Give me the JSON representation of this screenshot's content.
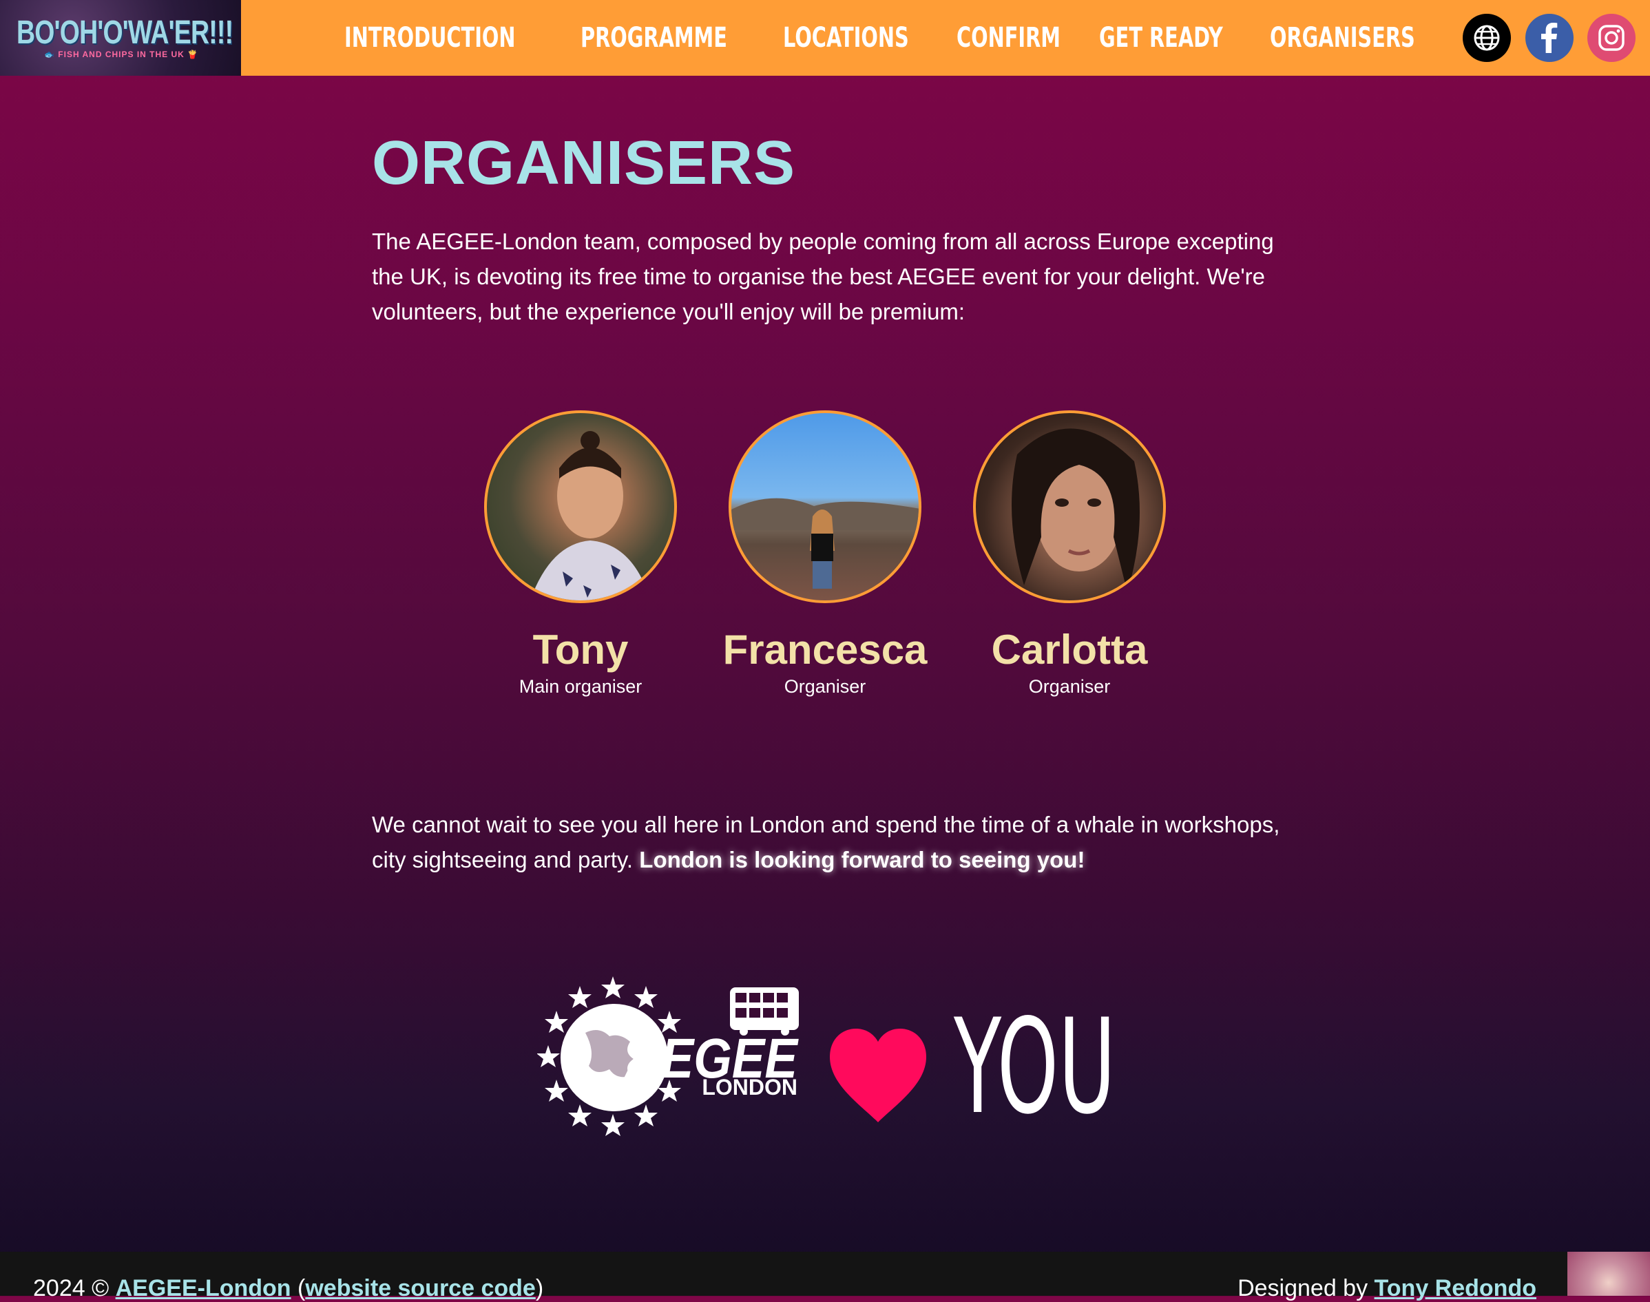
{
  "header": {
    "logo_title": "BO'OH'O'WA'ER!!!",
    "logo_subtitle": "🐟 FISH AND CHIPS IN THE UK 🍟",
    "nav": [
      "INTRODUCTION",
      "PROGRAMME",
      "LOCATIONS",
      "CONFIRM",
      "GET READY",
      "ORGANISERS"
    ],
    "social": [
      "globe-icon",
      "facebook-icon",
      "instagram-icon"
    ]
  },
  "main": {
    "title": "ORGANISERS",
    "intro": "The AEGEE-London team, composed by people coming from all across Europe excepting the UK, is devoting its free time to organise the best AEGEE event for your delight. We're volunteers, but the experience you'll enjoy will be premium:",
    "organisers": [
      {
        "name": "Tony",
        "role": "Main organiser"
      },
      {
        "name": "Francesca",
        "role": "Organiser"
      },
      {
        "name": "Carlotta",
        "role": "Organiser"
      }
    ],
    "outro": "We cannot wait to see you all here in London and spend the time of a whale in workshops, city sightseeing and party.",
    "outro_bold": "London is looking forward to seeing you!",
    "banner": {
      "logo_word": "AEGEE",
      "logo_sub": "LONDON",
      "you": "YOU"
    }
  },
  "footer": {
    "year_prefix": "2024 ©",
    "org_link": "AEGEE-London",
    "source_link": "website source code",
    "designed_by": "Designed by",
    "designer_link": "Tony Redondo"
  },
  "colors": {
    "nav_bg": "#ff9d36",
    "title": "#a8e3e8",
    "name": "#f3e1a8",
    "heart": "#ff0a5c"
  }
}
